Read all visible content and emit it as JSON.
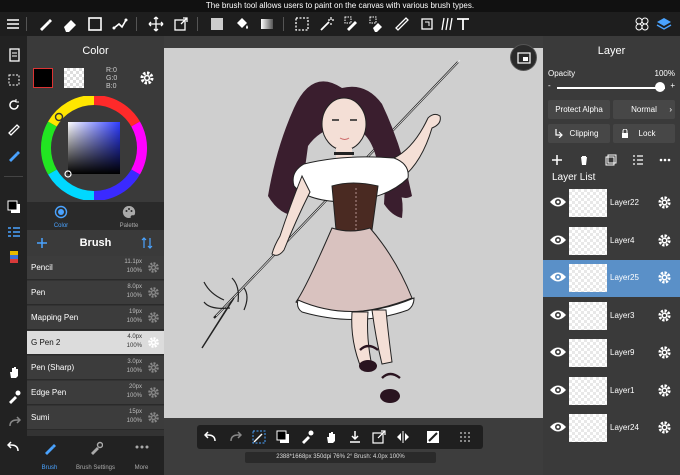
{
  "tooltip": "The brush tool allows users to paint on the canvas with various brush types.",
  "toolbar": {
    "tools": [
      "menu-icon",
      "brush-icon",
      "eraser-icon",
      "selection-icon",
      "lasso-icon",
      "move-icon",
      "transform-icon",
      "fill-color-icon",
      "bucket-icon",
      "gradient-icon",
      "select-layer-icon",
      "magic-wand-icon",
      "select-pen-icon",
      "select-eraser-icon",
      "text-icon"
    ],
    "right": [
      "materials-icon",
      "layers-icon"
    ]
  },
  "color_panel": {
    "title": "Color",
    "r": "R:0",
    "g": "G:0",
    "b": "B:0",
    "tabs": [
      {
        "label": "Color"
      },
      {
        "label": "Palette"
      }
    ]
  },
  "brush_panel": {
    "title": "Brush",
    "items": [
      {
        "name": "Pencil",
        "size": "11.1px",
        "opacity": "100%"
      },
      {
        "name": "Pen",
        "size": "8.0px",
        "opacity": "100%"
      },
      {
        "name": "Mapping Pen",
        "size": "19px",
        "opacity": "100%"
      },
      {
        "name": "G Pen 2",
        "size": "4.0px",
        "opacity": "100%"
      },
      {
        "name": "Pen (Sharp)",
        "size": "3.0px",
        "opacity": "100%"
      },
      {
        "name": "Edge Pen",
        "size": "20px",
        "opacity": "100%"
      },
      {
        "name": "Sumi",
        "size": "15px",
        "opacity": "100%"
      }
    ],
    "active_index": 3
  },
  "bottom_tabs": [
    {
      "label": "Brush"
    },
    {
      "label": "Brush Settings"
    },
    {
      "label": "More"
    }
  ],
  "status": "2388*1668px 350dpi 76% 2° Brush: 4.0px 100%",
  "layer_panel": {
    "title": "Layer",
    "opacity_label": "Opacity",
    "opacity_value": "100%",
    "opacity_level": 1.0,
    "minus": "-",
    "plus": "+",
    "protect_alpha": "Protect Alpha",
    "blend_mode": "Normal",
    "clipping": "Clipping",
    "lock": "Lock",
    "list_title": "Layer List",
    "layers": [
      {
        "name": "Layer22"
      },
      {
        "name": "Layer4"
      },
      {
        "name": "Layer25"
      },
      {
        "name": "Layer3"
      },
      {
        "name": "Layer9"
      },
      {
        "name": "Layer1"
      },
      {
        "name": "Layer24"
      }
    ],
    "active_index": 2
  },
  "colors": {
    "accent": "#4aa3ff",
    "active_layer": "#5a90c8",
    "current_color": "#000000"
  }
}
